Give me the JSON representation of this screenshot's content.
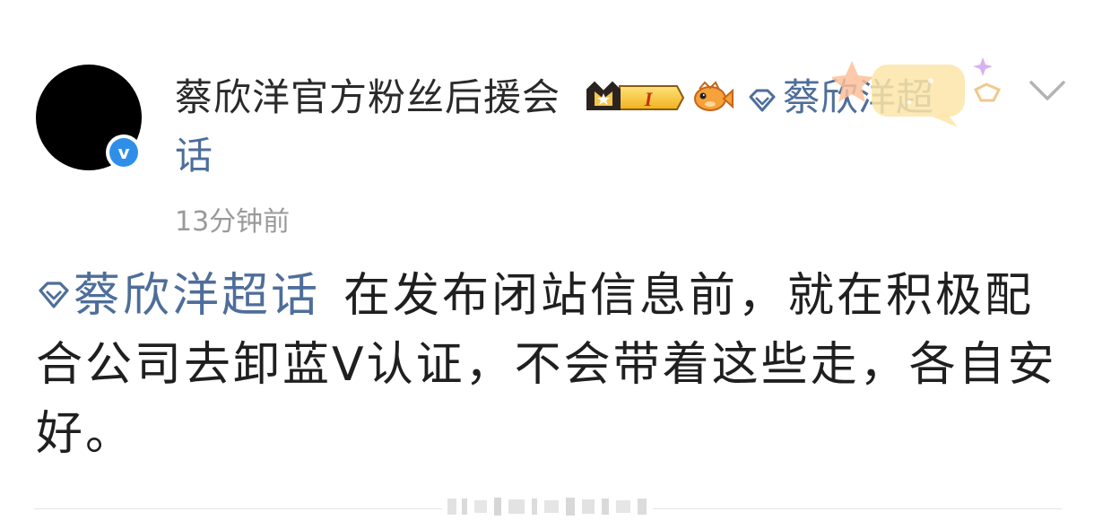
{
  "post": {
    "author": {
      "name": "蔡欣洋官方粉丝后援会",
      "verified": true,
      "verified_badge": "v",
      "member_level": "I"
    },
    "topic_tag": {
      "label": "蔡欣洋超",
      "label_wrap": "话"
    },
    "timestamp": "13分钟前",
    "body": {
      "topic": "蔡欣洋超话",
      "text": "在发布闭站信息前，就在积极配合公司去卸蓝V认证，不会带着这些走，各自安好。"
    }
  },
  "colors": {
    "topic_link": "#4e6e9a",
    "verified_blue": "#2f8fe8",
    "timestamp_gray": "#9a9a9a",
    "text": "#1f1f1f"
  },
  "icons": {
    "crown": "crown-icon",
    "fish": "fish-icon",
    "gem": "gem-icon",
    "dropdown": "chevron-down-icon"
  }
}
